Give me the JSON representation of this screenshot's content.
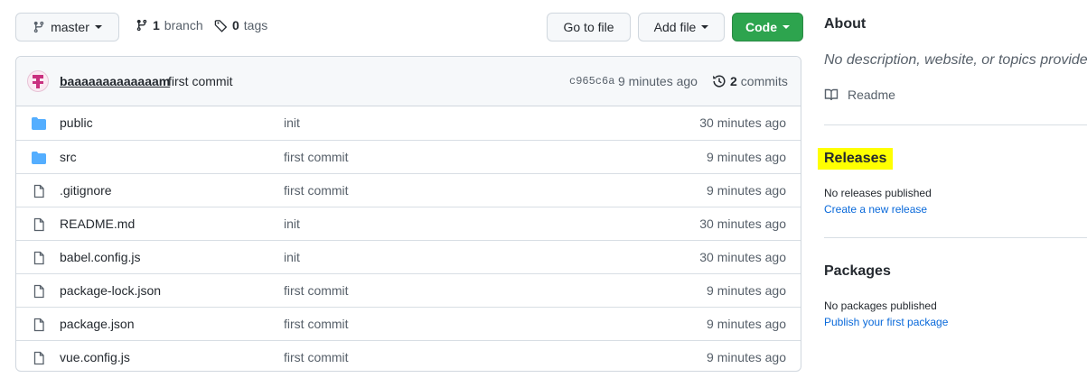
{
  "toolbar": {
    "branch_label": "master",
    "branch_count": "1",
    "branch_word": "branch",
    "tags_count": "0",
    "tags_word": "tags",
    "go_to_file": "Go to file",
    "add_file": "Add file",
    "code": "Code"
  },
  "commit": {
    "author": "baaaaaaaaaaaaam",
    "message": "first commit",
    "sha": "c965c6a",
    "time": "9 minutes ago",
    "commits_count": "2",
    "commits_word": "commits"
  },
  "files": [
    {
      "type": "folder",
      "name": "public",
      "message": "init",
      "age": "30 minutes ago"
    },
    {
      "type": "folder",
      "name": "src",
      "message": "first commit",
      "age": "9 minutes ago"
    },
    {
      "type": "file",
      "name": ".gitignore",
      "message": "first commit",
      "age": "9 minutes ago"
    },
    {
      "type": "file",
      "name": "README.md",
      "message": "init",
      "age": "30 minutes ago"
    },
    {
      "type": "file",
      "name": "babel.config.js",
      "message": "init",
      "age": "30 minutes ago"
    },
    {
      "type": "file",
      "name": "package-lock.json",
      "message": "first commit",
      "age": "9 minutes ago"
    },
    {
      "type": "file",
      "name": "package.json",
      "message": "first commit",
      "age": "9 minutes ago"
    },
    {
      "type": "file",
      "name": "vue.config.js",
      "message": "first commit",
      "age": "9 minutes ago"
    }
  ],
  "sidebar": {
    "about_title": "About",
    "about_desc": "No description, website, or topics provided.",
    "readme": "Readme",
    "releases_title": "Releases",
    "releases_empty": "No releases published",
    "releases_link": "Create a new release",
    "packages_title": "Packages",
    "packages_empty": "No packages published",
    "packages_link": "Publish your first package"
  },
  "colors": {
    "code_button": "#2da44e",
    "highlight": "#ffff00",
    "link": "#0969da",
    "folder": "#54aeff"
  }
}
